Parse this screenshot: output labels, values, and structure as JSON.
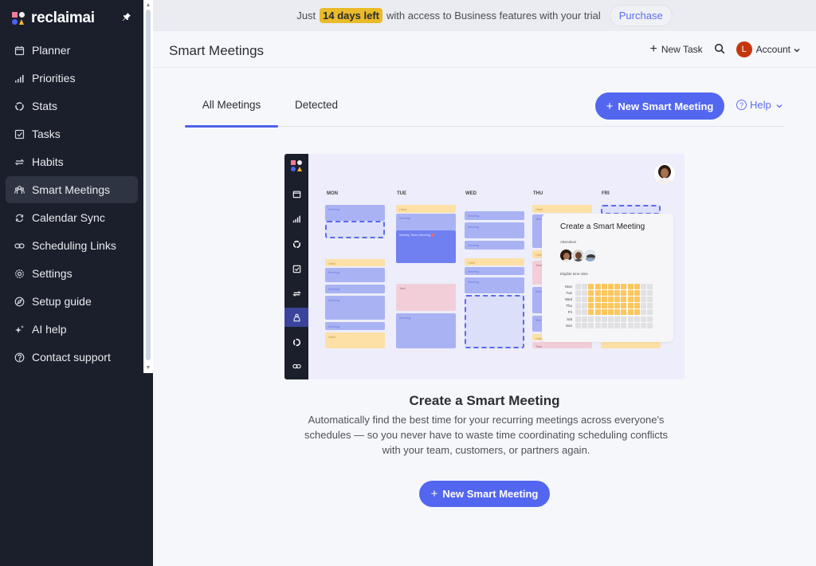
{
  "app": {
    "brand": "reclaimai",
    "page_title": "Smart Meetings"
  },
  "sidebar": {
    "items": [
      {
        "label": "Planner",
        "icon": "calendar-icon"
      },
      {
        "label": "Priorities",
        "icon": "bars-icon"
      },
      {
        "label": "Stats",
        "icon": "ring-icon"
      },
      {
        "label": "Tasks",
        "icon": "checkbox-icon"
      },
      {
        "label": "Habits",
        "icon": "repeat-icon"
      },
      {
        "label": "Smart Meetings",
        "icon": "people-icon",
        "active": true
      },
      {
        "label": "Calendar Sync",
        "icon": "sync-icon"
      },
      {
        "label": "Scheduling Links",
        "icon": "link-icon"
      },
      {
        "label": "Settings",
        "icon": "gear-icon"
      },
      {
        "label": "Setup guide",
        "icon": "compass-icon"
      },
      {
        "label": "AI help",
        "icon": "sparkle-icon"
      },
      {
        "label": "Contact support",
        "icon": "question-icon"
      }
    ]
  },
  "trial_banner": {
    "prefix": "Just",
    "highlight": "14 days left",
    "suffix": "with access to Business features with your trial",
    "purchase_label": "Purchase"
  },
  "header": {
    "new_task_label": "New Task",
    "account_initial": "L",
    "account_label": "Account"
  },
  "tabs": [
    {
      "label": "All Meetings",
      "active": true
    },
    {
      "label": "Detected",
      "active": false
    }
  ],
  "actions": {
    "new_smart_meeting_label": "New Smart Meeting",
    "help_label": "Help"
  },
  "illustration": {
    "days": [
      "MON",
      "TUE",
      "WED",
      "THU",
      "FRI"
    ],
    "meeting_label": "Meeting",
    "habit_label": "Habit",
    "task_label": "Task",
    "weekly_label": "Weekly Team Meeting",
    "card_title": "Create a Smart Meeting",
    "attendees_label": "Attendees",
    "eligible_label": "Eligible time slots",
    "grid_days": [
      "Mon",
      "Tue",
      "Wed",
      "Thu",
      "Fri",
      "Sat",
      "Sun"
    ],
    "grid_eligible": [
      [
        0,
        0,
        1,
        1,
        1,
        1,
        1,
        1,
        1,
        1,
        0,
        0
      ],
      [
        0,
        0,
        1,
        1,
        1,
        1,
        1,
        1,
        1,
        1,
        0,
        0
      ],
      [
        0,
        0,
        1,
        1,
        1,
        1,
        1,
        1,
        1,
        1,
        0,
        0
      ],
      [
        0,
        0,
        1,
        1,
        1,
        1,
        1,
        1,
        1,
        1,
        0,
        0
      ],
      [
        0,
        0,
        1,
        1,
        1,
        1,
        1,
        1,
        1,
        1,
        0,
        0
      ],
      [
        0,
        0,
        0,
        0,
        0,
        0,
        0,
        0,
        0,
        0,
        0,
        0
      ],
      [
        0,
        0,
        0,
        0,
        0,
        0,
        0,
        0,
        0,
        0,
        0,
        0
      ]
    ]
  },
  "empty_state": {
    "title": "Create a Smart Meeting",
    "description": "Automatically find the best time for your recurring meetings across everyone's schedules — so you never have to waste time coordinating scheduling conflicts with your team, customers, or partners again.",
    "button_label": "New Smart Meeting"
  },
  "colors": {
    "accent": "#5366f0",
    "highlight": "#e9ba2a",
    "sidebar_bg": "#1a1f2b",
    "avatar": "#c3360f"
  }
}
